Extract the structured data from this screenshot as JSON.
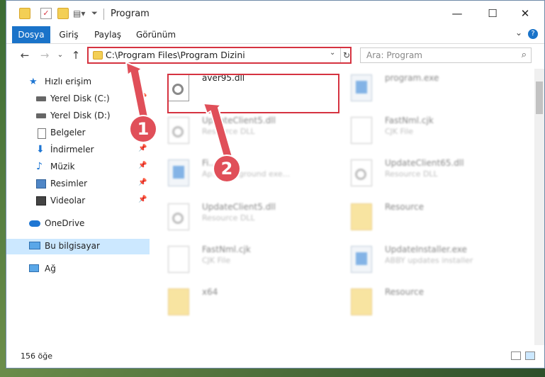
{
  "window": {
    "title": "Program",
    "minimize": "—",
    "maximize": "☐",
    "close": "✕"
  },
  "ribbon": {
    "tabs": [
      "Dosya",
      "Giriş",
      "Paylaş",
      "Görünüm"
    ],
    "help": "?",
    "expand": "⌄"
  },
  "nav": {
    "back": "←",
    "forward": "→",
    "recent": "⌄",
    "up": "↑",
    "address": "C:\\Program Files\\Program Dizini",
    "address_dropdown": "⌄",
    "refresh": "↻",
    "search_placeholder": "Ara: Program",
    "search_icon": "⌕"
  },
  "sidebar": {
    "items": [
      {
        "label": "Hızlı erişim",
        "icon": "star-icon",
        "pinned": false
      },
      {
        "label": "Yerel Disk (C:)",
        "icon": "drive-icon",
        "pinned": true
      },
      {
        "label": "Yerel Disk (D:)",
        "icon": "drive-icon",
        "pinned": false
      },
      {
        "label": "Belgeler",
        "icon": "document-icon",
        "pinned": true
      },
      {
        "label": "İndirmeler",
        "icon": "download-icon",
        "pinned": true
      },
      {
        "label": "Müzik",
        "icon": "music-icon",
        "pinned": true
      },
      {
        "label": "Resimler",
        "icon": "pictures-icon",
        "pinned": true
      },
      {
        "label": "Videolar",
        "icon": "video-icon",
        "pinned": true
      },
      {
        "label": "OneDrive",
        "icon": "cloud-icon",
        "pinned": false
      },
      {
        "label": "Bu bilgisayar",
        "icon": "computer-icon",
        "pinned": false,
        "selected": true
      },
      {
        "label": "Ağ",
        "icon": "network-icon",
        "pinned": false
      }
    ],
    "pin_glyph": "📌"
  },
  "files": [
    {
      "name": "aver95.dll",
      "sub": "",
      "type": "dll",
      "highlight": true
    },
    {
      "name": "program.exe",
      "sub": "",
      "type": "exe"
    },
    {
      "name": "UpdateClient5.dll",
      "sub": "Resource DLL",
      "type": "dll"
    },
    {
      "name": "FastNml.cjk",
      "sub": "CJK File",
      "type": "doc"
    },
    {
      "name": "Fi...exe",
      "sub": "Ap...Background exe...",
      "type": "exe"
    },
    {
      "name": "UpdateClient65.dll",
      "sub": "Resource DLL",
      "type": "dll"
    },
    {
      "name": "UpdateClient5.dll",
      "sub": "Resource DLL",
      "type": "dll"
    },
    {
      "name": "Resource",
      "sub": "",
      "type": "folder"
    },
    {
      "name": "FastNml.cjk",
      "sub": "CJK File",
      "type": "doc"
    },
    {
      "name": "UpdateInstaller.exe",
      "sub": "ABBY updates installer",
      "type": "exe"
    },
    {
      "name": "x64",
      "sub": "",
      "type": "folder"
    },
    {
      "name": "Resource",
      "sub": "",
      "type": "folder"
    }
  ],
  "status": {
    "count": "156 öğe"
  },
  "annotations": {
    "step1": "1",
    "step2": "2",
    "color": "#e04f59"
  }
}
